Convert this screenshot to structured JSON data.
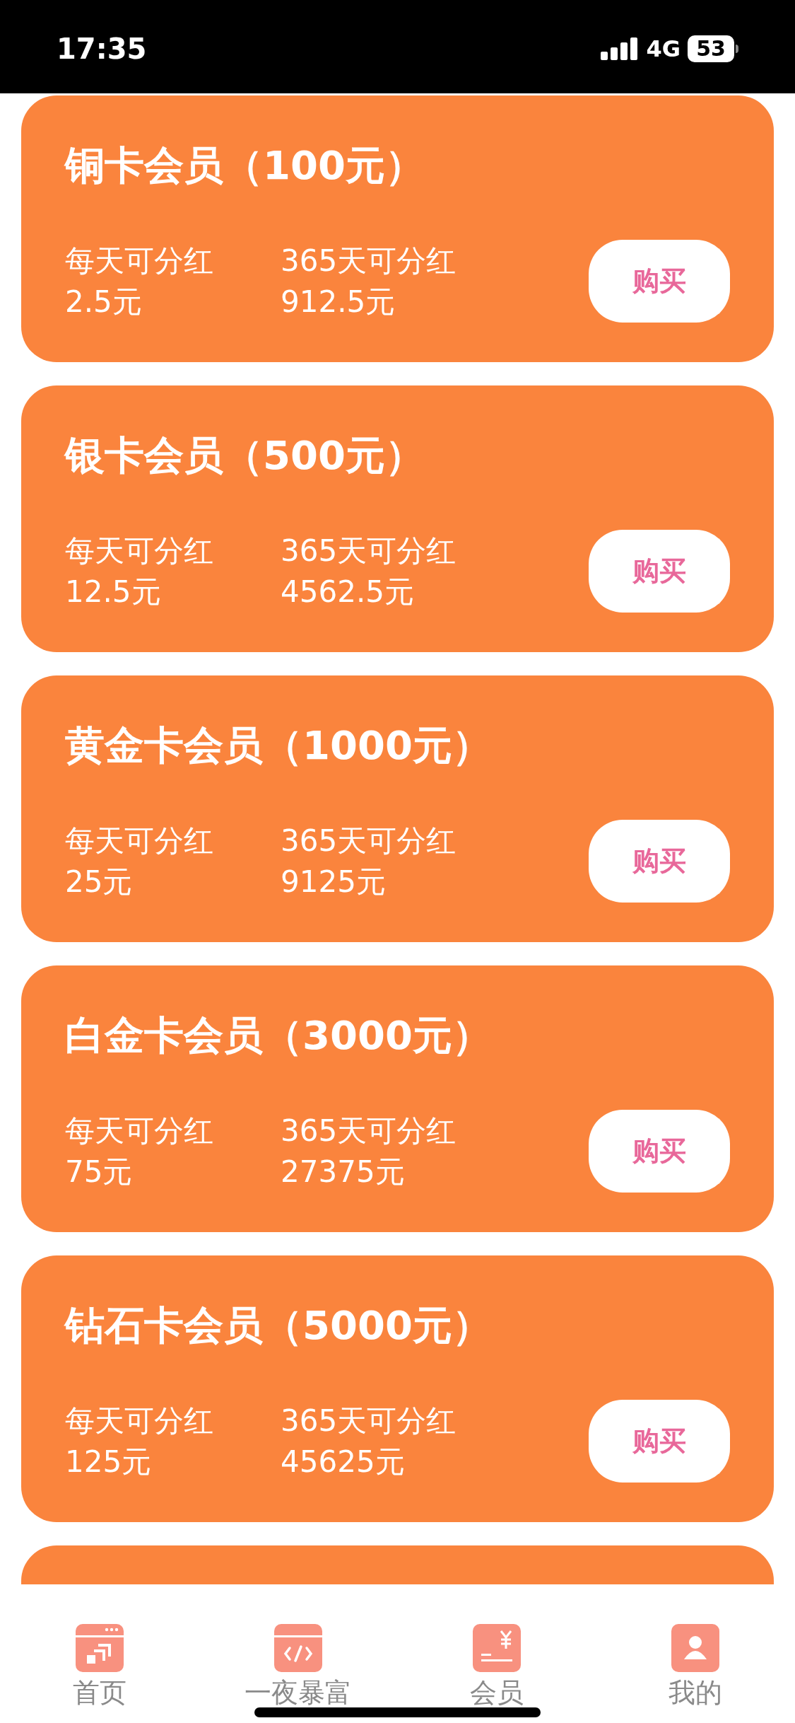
{
  "status_bar": {
    "time": "17:35",
    "network": "4G",
    "battery": "53"
  },
  "cards": [
    {
      "title": "铜卡会员（100元）",
      "daily_label": "每天可分红",
      "daily_value": "2.5元",
      "yearly_label": "365天可分红",
      "yearly_value": "912.5元",
      "button": "购买"
    },
    {
      "title": "银卡会员（500元）",
      "daily_label": "每天可分红",
      "daily_value": "12.5元",
      "yearly_label": "365天可分红",
      "yearly_value": "4562.5元",
      "button": "购买"
    },
    {
      "title": "黄金卡会员（1000元）",
      "daily_label": "每天可分红",
      "daily_value": "25元",
      "yearly_label": "365天可分红",
      "yearly_value": "9125元",
      "button": "购买"
    },
    {
      "title": "白金卡会员（3000元）",
      "daily_label": "每天可分红",
      "daily_value": "75元",
      "yearly_label": "365天可分红",
      "yearly_value": "27375元",
      "button": "购买"
    },
    {
      "title": "钻石卡会员（5000元）",
      "daily_label": "每天可分红",
      "daily_value": "125元",
      "yearly_label": "365天可分红",
      "yearly_value": "45625元",
      "button": "购买"
    }
  ],
  "more_cards_below": true,
  "tabs": [
    {
      "kind": "home",
      "label": "首页",
      "selected": false
    },
    {
      "kind": "code",
      "label": "一夜暴富",
      "selected": false
    },
    {
      "kind": "money",
      "label": "会员",
      "selected": false
    },
    {
      "kind": "person",
      "label": "我的",
      "selected": false
    }
  ]
}
